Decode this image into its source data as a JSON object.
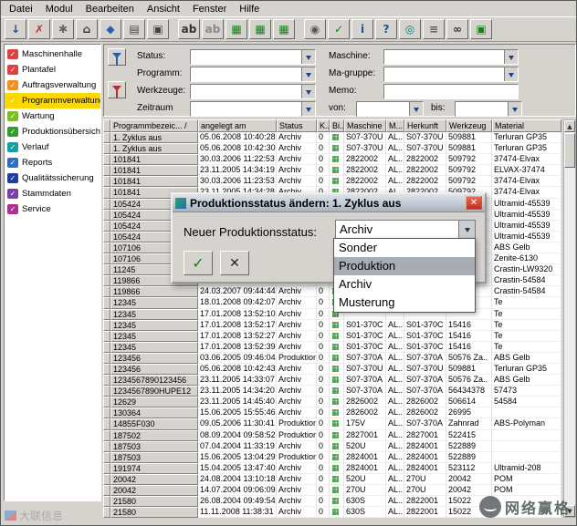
{
  "menubar": {
    "items": [
      "Datei",
      "Modul",
      "Bearbeiten",
      "Ansicht",
      "Fenster",
      "Hilfe"
    ]
  },
  "toolbar": {
    "groups": [
      [
        {
          "name": "import-icon",
          "glyph": "↓",
          "color": "#1f4fa0"
        },
        {
          "name": "delete-icon",
          "glyph": "✗",
          "color": "#c03030"
        },
        {
          "name": "settings-icon",
          "glyph": "✱",
          "color": "#666666"
        },
        {
          "name": "home-icon",
          "glyph": "⌂",
          "color": "#333333"
        },
        {
          "name": "modules-icon",
          "glyph": "◆",
          "color": "#2a5fb0"
        },
        {
          "name": "preview-icon",
          "glyph": "▤",
          "color": "#444444"
        },
        {
          "name": "print-icon",
          "glyph": "▣",
          "color": "#444444"
        }
      ],
      [
        {
          "name": "spellcheck-icon",
          "glyph": "ab",
          "color": "#333333"
        },
        {
          "name": "text-icon",
          "glyph": "ab",
          "color": "#888888"
        },
        {
          "name": "table-export-icon",
          "glyph": "▦",
          "color": "#15801a"
        },
        {
          "name": "table-import-icon",
          "glyph": "▦",
          "color": "#15801a"
        },
        {
          "name": "table-refresh-icon",
          "glyph": "▦",
          "color": "#15801a"
        }
      ],
      [
        {
          "name": "clock-icon",
          "glyph": "◉",
          "color": "#555555"
        },
        {
          "name": "ok-icon",
          "glyph": "✓",
          "color": "#15801a"
        },
        {
          "name": "info-icon",
          "glyph": "i",
          "color": "#1f4fa0"
        },
        {
          "name": "help-icon",
          "glyph": "?",
          "color": "#1f4fa0"
        },
        {
          "name": "view-icon",
          "glyph": "◎",
          "color": "#0a7a7a"
        },
        {
          "name": "list-icon",
          "glyph": "≡",
          "color": "#555555"
        },
        {
          "name": "binocular-icon",
          "glyph": "∞",
          "color": "#333333"
        },
        {
          "name": "status-icon",
          "glyph": "▣",
          "color": "#15801a"
        }
      ]
    ]
  },
  "sidebar": {
    "items": [
      {
        "label": "Maschinenhalle",
        "color": "#e04040",
        "selected": false
      },
      {
        "label": "Plantafel",
        "color": "#e04040",
        "selected": false
      },
      {
        "label": "Auftragsverwaltung",
        "color": "#f09020",
        "selected": false
      },
      {
        "label": "Programmverwaltung",
        "color": "#f5d800",
        "selected": true
      },
      {
        "label": "Wartung",
        "color": "#7ac020",
        "selected": false
      },
      {
        "label": "Produktionsübersicht",
        "color": "#2f9e2f",
        "selected": false
      },
      {
        "label": "Verlauf",
        "color": "#17a0a0",
        "selected": false
      },
      {
        "label": "Reports",
        "color": "#2f6fc0",
        "selected": false
      },
      {
        "label": "Qualitätssicherung",
        "color": "#1f3f9f",
        "selected": false
      },
      {
        "label": "Stammdaten",
        "color": "#7840a8",
        "selected": false
      },
      {
        "label": "Service",
        "color": "#b03090",
        "selected": false
      }
    ]
  },
  "filters": {
    "status_label": "Status:",
    "programm_label": "Programm:",
    "werkzeuge_label": "Werkzeuge:",
    "zeitraum_label": "Zeitraum",
    "maschine_label": "Maschine:",
    "magruppe_label": "Ma-gruppe:",
    "memo_label": "Memo:",
    "von_label": "von:",
    "bis_label": "bis:",
    "status_value": "",
    "programm_value": "",
    "werkzeuge_value": "",
    "zeitraum_value": "",
    "maschine_value": "",
    "magruppe_value": "",
    "memo_value": "",
    "von_value": "",
    "bis_value": ""
  },
  "scrollbar": {
    "up_glyph": "▲",
    "down_glyph": "▼"
  },
  "table": {
    "columns": [
      "",
      "Programmbezeic... /",
      "angelegt am",
      "Status",
      "K...",
      "Bi...",
      "Maschine",
      "M...",
      "Herkunft",
      "Werkzeug",
      "Material"
    ],
    "rows": [
      [
        "1. Zyklus aus",
        "05.06.2008 10:40:28",
        "Archiv",
        "0",
        "S07-370U",
        "AL..",
        "S07-370U",
        "509881",
        "Terluran GP35"
      ],
      [
        "1. Zyklus aus",
        "05.06.2008 10:42:30",
        "Archiv",
        "0",
        "S07-370U",
        "AL..",
        "S07-370U",
        "509881",
        "Terluran GP35"
      ],
      [
        "101841",
        "30.03.2006 11:22:53",
        "Archiv",
        "0",
        "2822002",
        "AL..",
        "2822002",
        "509792",
        "37474-Elvax"
      ],
      [
        "101841",
        "23.11.2005 14:34:19",
        "Archiv",
        "0",
        "2822002",
        "AL..",
        "2822002",
        "509792",
        "ELVAX-37474"
      ],
      [
        "101841",
        "30.03.2006 11:23:53",
        "Archiv",
        "0",
        "2822002",
        "AL..",
        "2822002",
        "509792",
        "37474-Elvax"
      ],
      [
        "101841",
        "23.11.2005 14:34:28",
        "Archiv",
        "0",
        "2822002",
        "AL..",
        "2822002",
        "509792",
        "37474-Elvax"
      ],
      [
        "105424",
        "",
        "",
        "",
        "",
        "",
        "",
        "",
        "Ultramid-45539"
      ],
      [
        "105424",
        "",
        "",
        "",
        "",
        "",
        "",
        "",
        "Ultramid-45539"
      ],
      [
        "105424",
        "",
        "",
        "",
        "",
        "",
        "",
        "",
        "Ultramid-45539"
      ],
      [
        "105424",
        "",
        "",
        "",
        "",
        "",
        "",
        "",
        "Ultramid-45539"
      ],
      [
        "107106",
        "",
        "",
        "",
        "",
        "",
        "",
        "",
        "ABS Gelb"
      ],
      [
        "107106",
        "",
        "",
        "",
        "",
        "",
        "",
        "",
        "Zenite-6130"
      ],
      [
        "11245",
        "",
        "",
        "",
        "",
        "",
        "",
        "",
        "Crastin-LW9320"
      ],
      [
        "119866",
        "",
        "",
        "",
        "",
        "",
        "",
        "",
        "Crastin-54584"
      ],
      [
        "119866",
        "24.03.2007 09:44:44",
        "Archiv",
        "0",
        "",
        "",
        "",
        "",
        "Crastin-54584"
      ],
      [
        "12345",
        "18.01.2008 09:42:07",
        "Archiv",
        "0",
        "",
        "",
        "",
        "",
        "Te"
      ],
      [
        "12345",
        "17.01.2008 13:52:10",
        "Archiv",
        "0",
        "",
        "",
        "",
        "",
        "Te"
      ],
      [
        "12345",
        "17.01.2008 13:52:17",
        "Archiv",
        "0",
        "S01-370C",
        "AL..",
        "S01-370C",
        "15416",
        "Te"
      ],
      [
        "12345",
        "17.01.2008 13:52:27",
        "Archiv",
        "0",
        "S01-370C",
        "AL..",
        "S01-370C",
        "15416",
        "Te"
      ],
      [
        "12345",
        "17.01.2008 13:52:39",
        "Archiv",
        "0",
        "S01-370C",
        "AL..",
        "S01-370C",
        "15416",
        "Te"
      ],
      [
        "123456",
        "03.06.2005 09:46:04",
        "Produktion",
        "0",
        "S07-370A",
        "AL..",
        "S07-370A",
        "50576 Za..",
        "ABS Gelb"
      ],
      [
        "123456",
        "05.06.2008 10:42:43",
        "Archiv",
        "0",
        "S07-370U",
        "AL..",
        "S07-370U",
        "509881",
        "Terluran GP35"
      ],
      [
        "1234567890123456",
        "23.11.2005 14:33:07",
        "Archiv",
        "0",
        "S07-370A",
        "AL..",
        "S07-370A",
        "50576 Za..",
        "ABS Gelb"
      ],
      [
        "1234567890HUPE12",
        "23.11.2005 14:34:20",
        "Archiv",
        "0",
        "S07-370A",
        "AL..",
        "S07-370A",
        "56434378",
        "57473"
      ],
      [
        "12629",
        "23.11.2005 14:45:40",
        "Archiv",
        "0",
        "2826002",
        "AL..",
        "2826002",
        "506614",
        "54584"
      ],
      [
        "130364",
        "15.06.2005 15:55:46",
        "Archiv",
        "0",
        "2826002",
        "AL..",
        "2826002",
        "26995",
        ""
      ],
      [
        "14855F030",
        "09.05.2006 11:30:41",
        "Produktion",
        "0",
        "175V",
        "AL..",
        "S07-370A",
        "Zahnrad",
        "ABS-Polyman"
      ],
      [
        "187502",
        "08.09.2004 09:58:52",
        "Produktion",
        "0",
        "2827001",
        "AL..",
        "2827001",
        "522415",
        ""
      ],
      [
        "187503",
        "07.04.2004 11:33:19",
        "Archiv",
        "0",
        "520U",
        "AL..",
        "2824001",
        "522889",
        ""
      ],
      [
        "187503",
        "15.06.2005 13:04:29",
        "Produktion",
        "0",
        "2824001",
        "AL..",
        "2824001",
        "522889",
        ""
      ],
      [
        "191974",
        "15.04.2005 13:47:40",
        "Archiv",
        "0",
        "2824001",
        "AL..",
        "2824001",
        "523112",
        "Ultramid-208"
      ],
      [
        "20042",
        "24.08.2004 13:10:18",
        "Archiv",
        "0",
        "520U",
        "AL..",
        "270U",
        "20042",
        "POM"
      ],
      [
        "20042",
        "14.07.2004 09:06:09",
        "Archiv",
        "0",
        "270U",
        "AL..",
        "270U",
        "20042",
        "POM"
      ],
      [
        "21580",
        "26.08.2004 09:49:54",
        "Archiv",
        "0",
        "630S",
        "AL..",
        "2822001",
        "15022",
        ""
      ],
      [
        "21580",
        "11.11.2008 11:38:31",
        "Archiv",
        "0",
        "630S",
        "AL..",
        "2822001",
        "15022",
        ""
      ]
    ]
  },
  "dialog": {
    "title": "Produktionsstatus ändern: 1. Zyklus aus",
    "label": "Neuer Produktionsstatus:",
    "value": "Archiv",
    "options": [
      "Sonder",
      "Produktion",
      "Archiv",
      "Musterung"
    ],
    "highlighted_option": "Produktion",
    "ok_glyph": "✓",
    "cancel_glyph": "✕",
    "close_glyph": "✕"
  },
  "watermarks": {
    "left": "大联信息",
    "right": "网络赢格"
  }
}
